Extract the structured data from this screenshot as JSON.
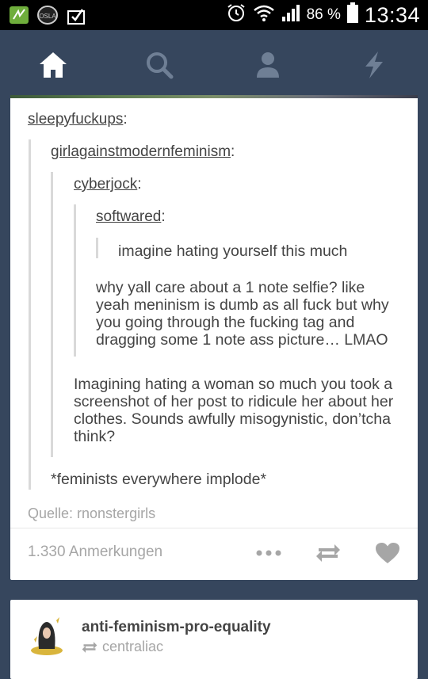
{
  "status": {
    "battery": "86 %",
    "time": "13:34"
  },
  "nav": {
    "items": [
      "home",
      "search",
      "account",
      "activity"
    ]
  },
  "post": {
    "reblog_chain": [
      {
        "user": "sleepyfuckups",
        "colon": ":"
      },
      {
        "user": "girlagainstmodernfeminism",
        "colon": ":"
      },
      {
        "user": "cyberjock",
        "colon": ":"
      },
      {
        "user": "softwared",
        "colon": ":"
      }
    ],
    "texts": {
      "t1": "imagine hating yourself this much",
      "t2": "why yall care about a 1 note selfie? like yeah meninism is dumb as all fuck but why you going through the fucking tag and dragging some 1 note ass picture… LMAO",
      "t3": "Imagining hating a woman so much you took a screenshot of her post to ridicule her about her clothes. Sounds awfully misogynistic, don’tcha think?",
      "t4": "*feminists everywhere implode*"
    },
    "source": "Quelle: rnonstergirls",
    "notes": "1.330 Anmerkungen"
  },
  "next_post": {
    "blog": "anti-feminism-pro-equality",
    "reblogged_from": "centraliac"
  }
}
